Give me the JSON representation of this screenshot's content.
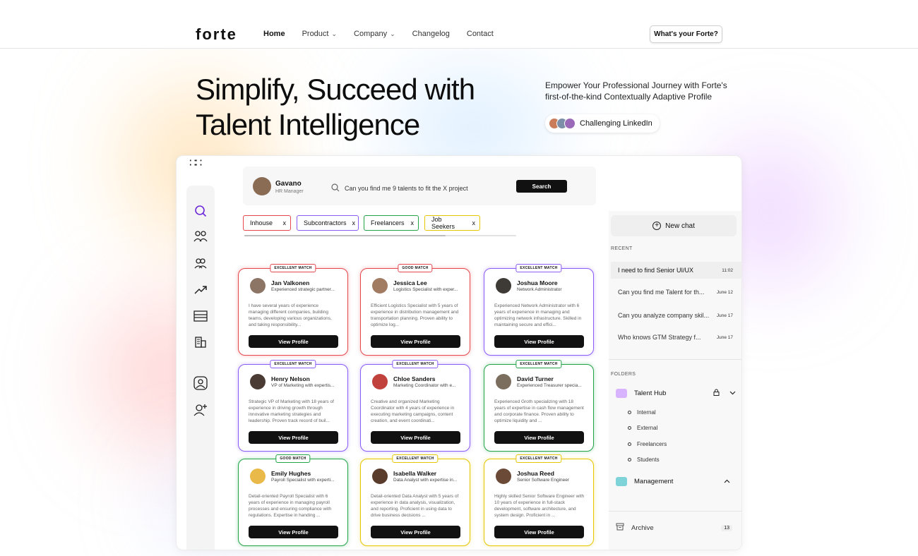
{
  "nav": {
    "logo": "forte",
    "links": [
      {
        "label": "Home",
        "active": true,
        "dropdown": false
      },
      {
        "label": "Product",
        "active": false,
        "dropdown": true
      },
      {
        "label": "Company",
        "active": false,
        "dropdown": true
      },
      {
        "label": "Changelog",
        "active": false,
        "dropdown": false
      },
      {
        "label": "Contact",
        "active": false,
        "dropdown": false
      }
    ],
    "cta": "What's your Forte?"
  },
  "hero": {
    "title_line1": "Simplify, Succeed with",
    "title_line2": "Talent Intelligence",
    "subtitle": "Empower Your Professional Journey with Forte's first-of-the-kind Contextually Adaptive Profile",
    "pill_label": "Challenging LinkedIn"
  },
  "app": {
    "user": {
      "name": "Gavano",
      "role": "HR Manager"
    },
    "search": {
      "query": "Can you find me 9  talents to fit the X project",
      "button": "Search"
    },
    "filters": [
      {
        "label": "Inhouse",
        "color": "#e5484d"
      },
      {
        "label": "Subcontractors",
        "color": "#8b5cf6"
      },
      {
        "label": "Freelancers",
        "color": "#22a447"
      },
      {
        "label": "Job Seekers",
        "color": "#e6c600"
      }
    ],
    "remove_glyph": "x",
    "cards": [
      {
        "badge": "EXCELLENT MATCH",
        "name": "Jan Valkonen",
        "role": "Experienced strategic partner...",
        "desc": "I have several years of experience managing different companies, building teams, developing various organizations, and taking responsibility...",
        "button": "View Profile",
        "color": "#e5484d"
      },
      {
        "badge": "GOOD MATCH",
        "name": "Jessica Lee",
        "role": "Logistics Specialist with exper...",
        "desc": "Efficient Logistics Specialist with 5 years of experience in distribution management and transportation planning. Proven ability to optimize log...",
        "button": "View Profile",
        "color": "#e5484d"
      },
      {
        "badge": "EXCELLENT MATCH",
        "name": "Joshua Moore",
        "role": "Network Administrator",
        "desc": "Experienced Network Administrator with 6 years of experience in managing and optimizing network infrastructure. Skilled in maintaining secure and effici...",
        "button": "View Profile",
        "color": "#8b5cf6"
      },
      {
        "badge": "EXCELLENT MATCH",
        "name": "Henry Nelson",
        "role": "VP of Marketing with expertis...",
        "desc": "Strategic VP of Marketing with 18 years of experience in driving growth through innovative marketing strategies and leadership. Proven track record of buil...",
        "button": "View Profile",
        "color": "#8b5cf6"
      },
      {
        "badge": "EXCELLENT MATCH",
        "name": "Chloe Sanders",
        "role": "Marketing Coordinator with e...",
        "desc": "Creative and organized Marketing Coordinator with 4 years of experience in executing marketing campaigns, content creation, and event coordinati...",
        "button": "View Profile",
        "color": "#8b5cf6"
      },
      {
        "badge": "EXCELLENT MATCH",
        "name": "David Turner",
        "role": "Experienced Treasurer specia...",
        "desc": "Experienced Groth specializing with 18 years of expertise in cash flow management and corporate finance. Proven ability to optimize liquidity and ...",
        "button": "View Profile",
        "color": "#22a447"
      },
      {
        "badge": "GOOD MATCH",
        "name": "Emily Hughes",
        "role": "Payroll Specialist with experti...",
        "desc": "Detail-oriented Payroll Specialist with 6 years of experience in managing payroll processes and ensuring compliance with regulations. Expertise in handing ...",
        "button": "View Profile",
        "color": "#22a447"
      },
      {
        "badge": "EXCELLENT MATCH",
        "name": "Isabella Walker",
        "role": "Data Analyst with expertise in...",
        "desc": "Detail-oriented Data Analyst with 5 years of experience in data analysis, visualization, and reporting. Proficient in using data to drive business decisions ...",
        "button": "View Profile",
        "color": "#e6c600"
      },
      {
        "badge": "EXCELLENT MATCH",
        "name": "Joshua Reed",
        "role": "Senior Software Engineer",
        "desc": "Highly skilled Senior Software Engineer with 10 years of experience in full-stack development, software architecture, and system design. Proficient in ...",
        "button": "View Profile",
        "color": "#e6c600"
      }
    ],
    "panel": {
      "new_chat": "New chat",
      "recent_label": "RECENT",
      "recent": [
        {
          "q": "I need to find Senior UI/UX",
          "t": "11:02",
          "active": true
        },
        {
          "q": "Can you find me Talent for th...",
          "t": "June 12",
          "active": false
        },
        {
          "q": "Can you analyze company skil...",
          "t": "June 17",
          "active": false
        },
        {
          "q": "Who knows GTM Strategy f...",
          "t": "June 17",
          "active": false
        }
      ],
      "folders_label": "FOLDERS",
      "folders": [
        {
          "name": "Talent Hub",
          "color": "#d8b4fe",
          "children": [
            "Internal",
            "External",
            "Freelancers",
            "Students"
          ]
        },
        {
          "name": "Management",
          "color": "#7dd3d8",
          "children": []
        }
      ],
      "archive": {
        "label": "Archive",
        "count": "13"
      }
    }
  }
}
